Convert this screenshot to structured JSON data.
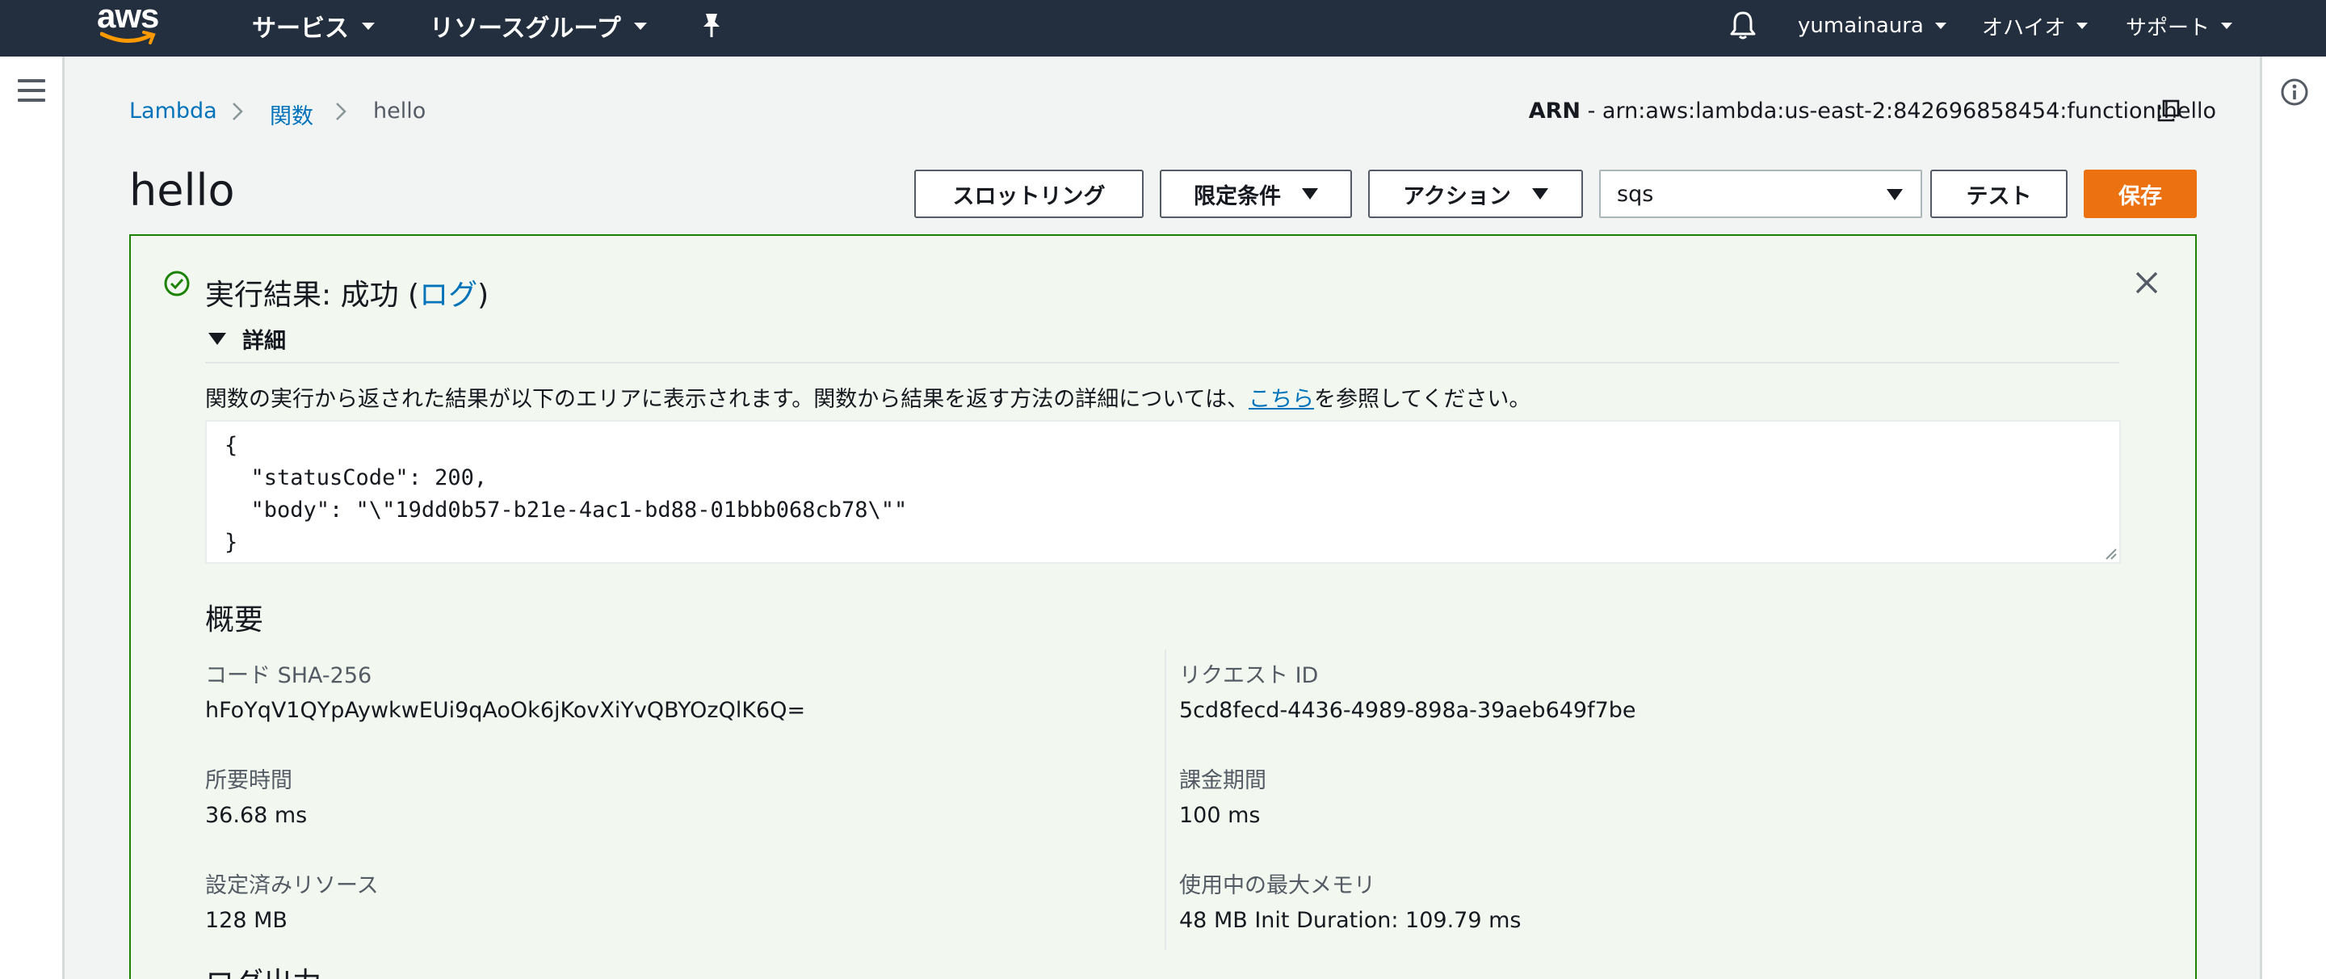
{
  "topnav": {
    "logo": "aws",
    "services": "サービス",
    "resource_groups": "リソースグループ",
    "user": "yumainaura",
    "region": "オハイオ",
    "support": "サポート",
    "bg_color": "#232f3e"
  },
  "breadcrumb": [
    "Lambda",
    "関数",
    "hello"
  ],
  "arn": {
    "label": "ARN",
    "value": "- arn:aws:lambda:us-east-2:842696858454:function:hello"
  },
  "page_title": "hello",
  "toolbar": {
    "throttle": "スロットリング",
    "qualifiers": "限定条件",
    "actions": "アクション",
    "test_event": "sqs",
    "test": "テスト",
    "save": "保存",
    "save_color": "#ec7211"
  },
  "result": {
    "title_prefix": "実行結果: 成功 (",
    "log_link": "ログ",
    "title_suffix": ")",
    "details": "詳細",
    "desc_prefix": "関数の実行から返された結果が以下のエリアに表示されます。関数から結果を返す方法の詳細については、",
    "desc_link": "こちら",
    "desc_suffix": "を参照してください。",
    "code_lines": [
      "{",
      "  \"statusCode\": 200,",
      "  \"body\": \"\\\"19dd0b57-b21e-4ac1-bd88-01bbb068cb78\\\"\"",
      "}"
    ],
    "success_color": "#1d8102"
  },
  "summary": {
    "heading": "概要",
    "sha_label": "コード SHA-256",
    "sha_value": "hFoYqV1QYpAywkwEUi9qAoOk6jKovXiYvQBYOzQlK6Q=",
    "request_label": "リクエスト ID",
    "request_value": "5cd8fecd-4436-4989-898a-39aeb649f7be",
    "duration_label": "所要時間",
    "duration_value": "36.68 ms",
    "billed_label": "課金期間",
    "billed_value": "100 ms",
    "resources_label": "設定済みリソース",
    "resources_value": "128 MB",
    "memory_label": "使用中の最大メモリ",
    "memory_value": "48 MB Init Duration: 109.79 ms"
  },
  "log_heading": "ログ出力"
}
